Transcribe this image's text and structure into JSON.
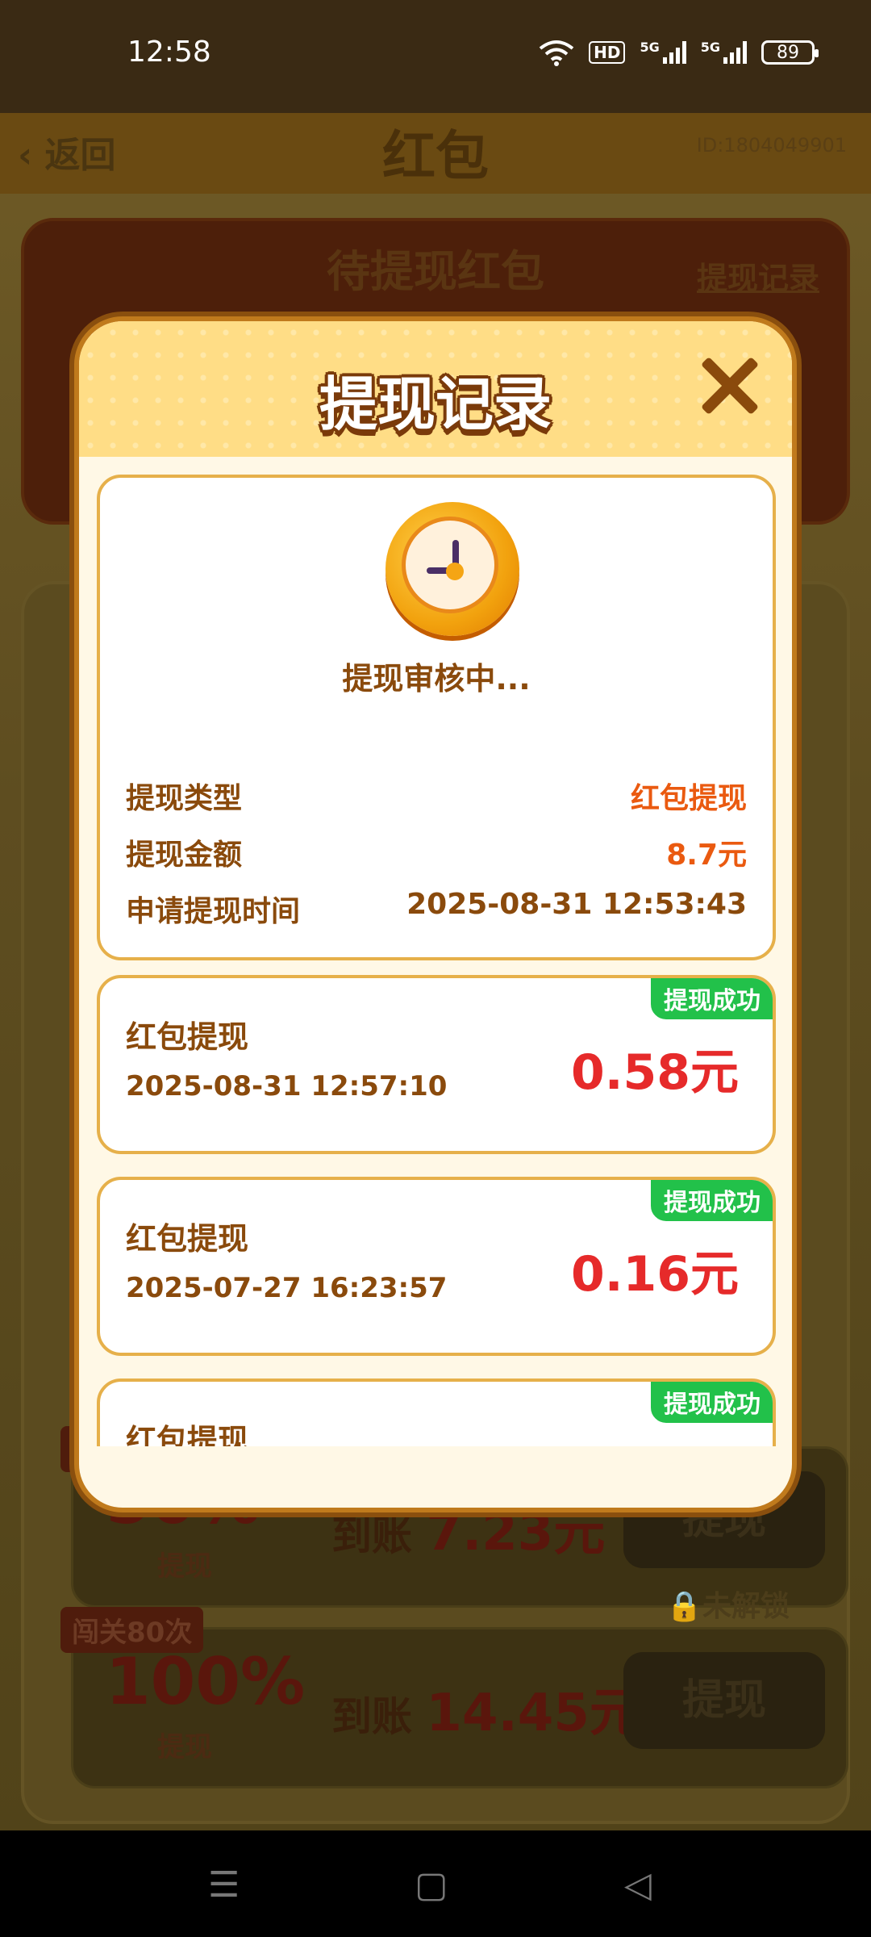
{
  "status_bar": {
    "time": "12:58",
    "battery": "89",
    "network_1": "5G",
    "network_2": "5G",
    "hd": "HD"
  },
  "background_page": {
    "back_label": "返回",
    "title": "红包",
    "user_id": "ID:1804049901",
    "redpacket_title": "待提现红包",
    "withdraw_record_link": "提现记录",
    "levels": [
      {
        "tag": "闯关80次",
        "percent": "100%",
        "percent_sub": "提现",
        "arrive_label": "到账",
        "arrive_amount": "14.45元",
        "button": "提现",
        "lock_label": "未解锁"
      },
      {
        "tag": "闯",
        "percent": "50%",
        "percent_sub": "提现",
        "arrive_label": "到账",
        "arrive_amount": "7.23元",
        "button": "提现"
      }
    ]
  },
  "modal": {
    "title": "提现记录",
    "pending": {
      "status": "提现审核中...",
      "type_label": "提现类型",
      "type_value": "红包提现",
      "amount_label": "提现金额",
      "amount_value": "8.7元",
      "time_label": "申请提现时间",
      "time_value": "2025-08-31 12:53:43"
    },
    "records": [
      {
        "title": "红包提现",
        "date": "2025-08-31 12:57:10",
        "amount": "0.58元",
        "status": "提现成功"
      },
      {
        "title": "红包提现",
        "date": "2025-07-27 16:23:57",
        "amount": "0.16元",
        "status": "提现成功"
      },
      {
        "title": "红包提现",
        "date": "",
        "amount": "",
        "status": "提现成功"
      }
    ]
  },
  "colors": {
    "accent_orange": "#ea5a10",
    "amount_red": "#e62a2a",
    "success_green": "#22c14a",
    "brown_text": "#8a4a0c"
  }
}
